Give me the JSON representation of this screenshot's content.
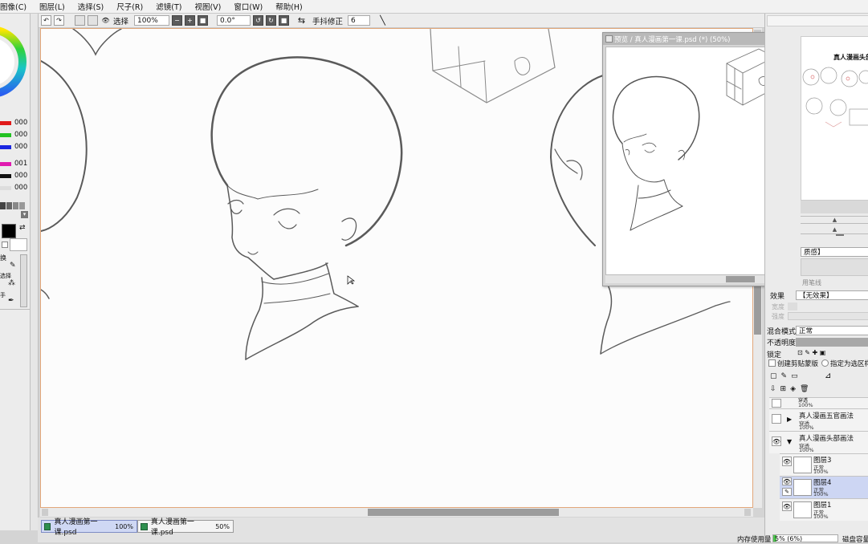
{
  "menu": [
    "图像(C)",
    "图层(L)",
    "选择(S)",
    "尺子(R)",
    "滤镜(T)",
    "视图(V)",
    "窗口(W)",
    "帮助(H)"
  ],
  "toolbar": {
    "select_label": "选择",
    "zoom": "100%",
    "angle": "0.0°",
    "stabilizer_label": "手抖修正",
    "stabilizer_value": "6"
  },
  "color_values": [
    "000",
    "000",
    "000",
    "001",
    "000",
    "000"
  ],
  "tool_labels": [
    "换",
    "选择",
    "手"
  ],
  "navigator": {
    "title": "预览 / 真人漫画第一课.psd (*) (50%)"
  },
  "right_panel": {
    "thumb_title": "真人漫画头部",
    "texture_label": "质感】",
    "effect_label": "效果",
    "effect_value": "【无效果】",
    "brush_label": "用笔线",
    "width_label": "宽度",
    "strength_label": "强度",
    "blend_label": "混合模式",
    "blend_value": "正常",
    "opacity_label": "不透明度",
    "lock_label": "锁定",
    "clip_label": "创建剪贴蒙版",
    "select_source_label": "指定为选区样"
  },
  "layers": [
    {
      "name": "",
      "mode": "穿透",
      "opacity": "100%",
      "folder": true,
      "collapsed": true
    },
    {
      "name": "真人漫画五官画法",
      "mode": "穿透",
      "opacity": "100%",
      "folder": true,
      "collapsed": true
    },
    {
      "name": "真人漫画头部画法",
      "mode": "穿透",
      "opacity": "100%",
      "folder": true,
      "collapsed": false
    },
    {
      "name": "图层3",
      "mode": "正常",
      "opacity": "100%",
      "folder": false
    },
    {
      "name": "图层4",
      "mode": "正常",
      "opacity": "100%",
      "folder": false,
      "selected": true
    },
    {
      "name": "图层1",
      "mode": "正常",
      "opacity": "100%",
      "folder": false
    }
  ],
  "tabs": [
    {
      "name": "真人漫画第一课.psd",
      "zoom": "100%",
      "active": true
    },
    {
      "name": "真人漫画第一课.psd",
      "zoom": "50%",
      "active": false
    }
  ],
  "status": {
    "memory_label": "内存使用量",
    "memory_value": "5% (6%)",
    "disk_label": "磁盘容量"
  },
  "colors": {
    "canvas_border": "#e2a77a",
    "selected_tab": "#cfd8f4",
    "selected_layer": "#cdd6f3"
  }
}
